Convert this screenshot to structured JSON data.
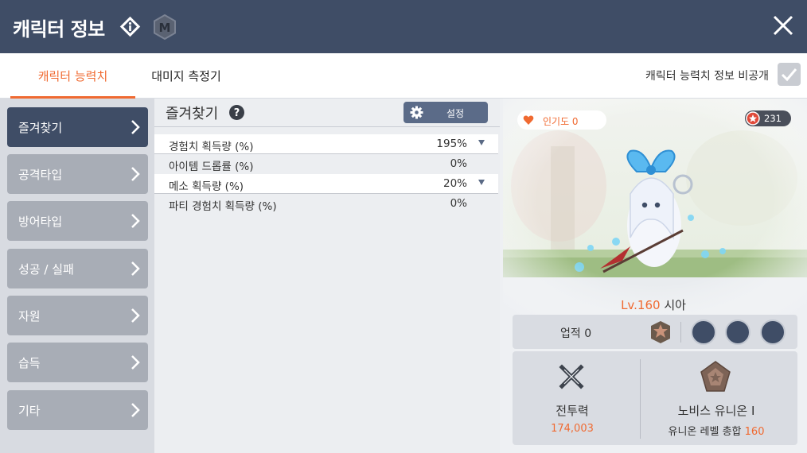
{
  "header": {
    "title": "캐릭터 정보"
  },
  "tabs": [
    {
      "label": "캐릭터 능력치",
      "active": true
    },
    {
      "label": "대미지 측정기",
      "active": false
    }
  ],
  "privacy": {
    "label": "캐릭터 능력치 정보 비공개",
    "checked": false
  },
  "sidebar": {
    "items": [
      {
        "label": "즐겨찾기",
        "active": true
      },
      {
        "label": "공격타입"
      },
      {
        "label": "방어타입"
      },
      {
        "label": "성공 / 실패"
      },
      {
        "label": "자원"
      },
      {
        "label": "습득"
      },
      {
        "label": "기타"
      }
    ]
  },
  "favorites": {
    "title": "즐겨찾기",
    "settings_label": "설정",
    "rows": [
      {
        "name": "경험치 획득량 (%)",
        "value": "195%",
        "expandable": true
      },
      {
        "name": "아이템 드롭률 (%)",
        "value": "0%",
        "expandable": false
      },
      {
        "name": "메소 획득량 (%)",
        "value": "20%",
        "expandable": true
      },
      {
        "name": "파티 경험치 획득량 (%)",
        "value": "0%",
        "expandable": false
      }
    ]
  },
  "profile": {
    "popularity": "인기도 0",
    "star_count": "231",
    "level": "Lv.160",
    "name": "시아",
    "achievement": "업적 0",
    "combat_power_label": "전투력",
    "combat_power": "174,003",
    "union_name": "노비스 유니온 I",
    "union_level_label": "유니온 레벨 총합",
    "union_level": "160"
  },
  "colors": {
    "header": "#3f4d66",
    "accent": "#f06a31",
    "sidebar_inactive": "#a8adb6"
  }
}
